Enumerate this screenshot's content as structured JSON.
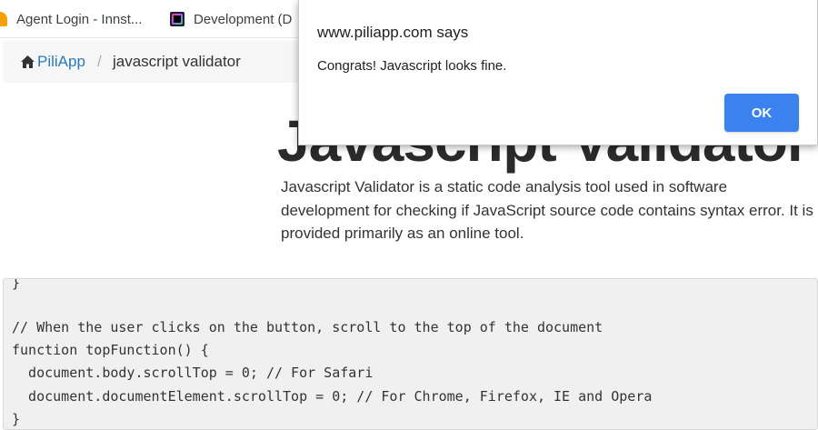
{
  "bookmarks": [
    {
      "label": "Agent Login - Innst...",
      "icon": "agent-bookmark-icon"
    },
    {
      "label": "Development (D",
      "icon": "jetbrains-bookmark-icon"
    }
  ],
  "breadcrumb": {
    "home_label": "PiliApp",
    "home_icon": "home-icon",
    "separator": "/",
    "current": "javascript validator"
  },
  "page": {
    "title": "Javascript Validator",
    "description": "Javascript Validator is a static code analysis tool used in software development for checking if JavaScript source code contains syntax error. It is provided primarily as an online tool."
  },
  "code": {
    "lines": [
      "}",
      "",
      "// When the user clicks on the button, scroll to the top of the document",
      "function topFunction() {",
      "  document.body.scrollTop = 0; // For Safari",
      "  document.documentElement.scrollTop = 0; // For Chrome, Firefox, IE and Opera",
      "}"
    ]
  },
  "dialog": {
    "title": "www.piliapp.com says",
    "message": "Congrats! Javascript looks fine.",
    "ok_label": "OK"
  },
  "colors": {
    "link": "#2a7ab8",
    "ok_button": "#3b82ee",
    "code_bg": "#f0f0f0",
    "breadcrumb_bg": "#f6f6f6"
  }
}
